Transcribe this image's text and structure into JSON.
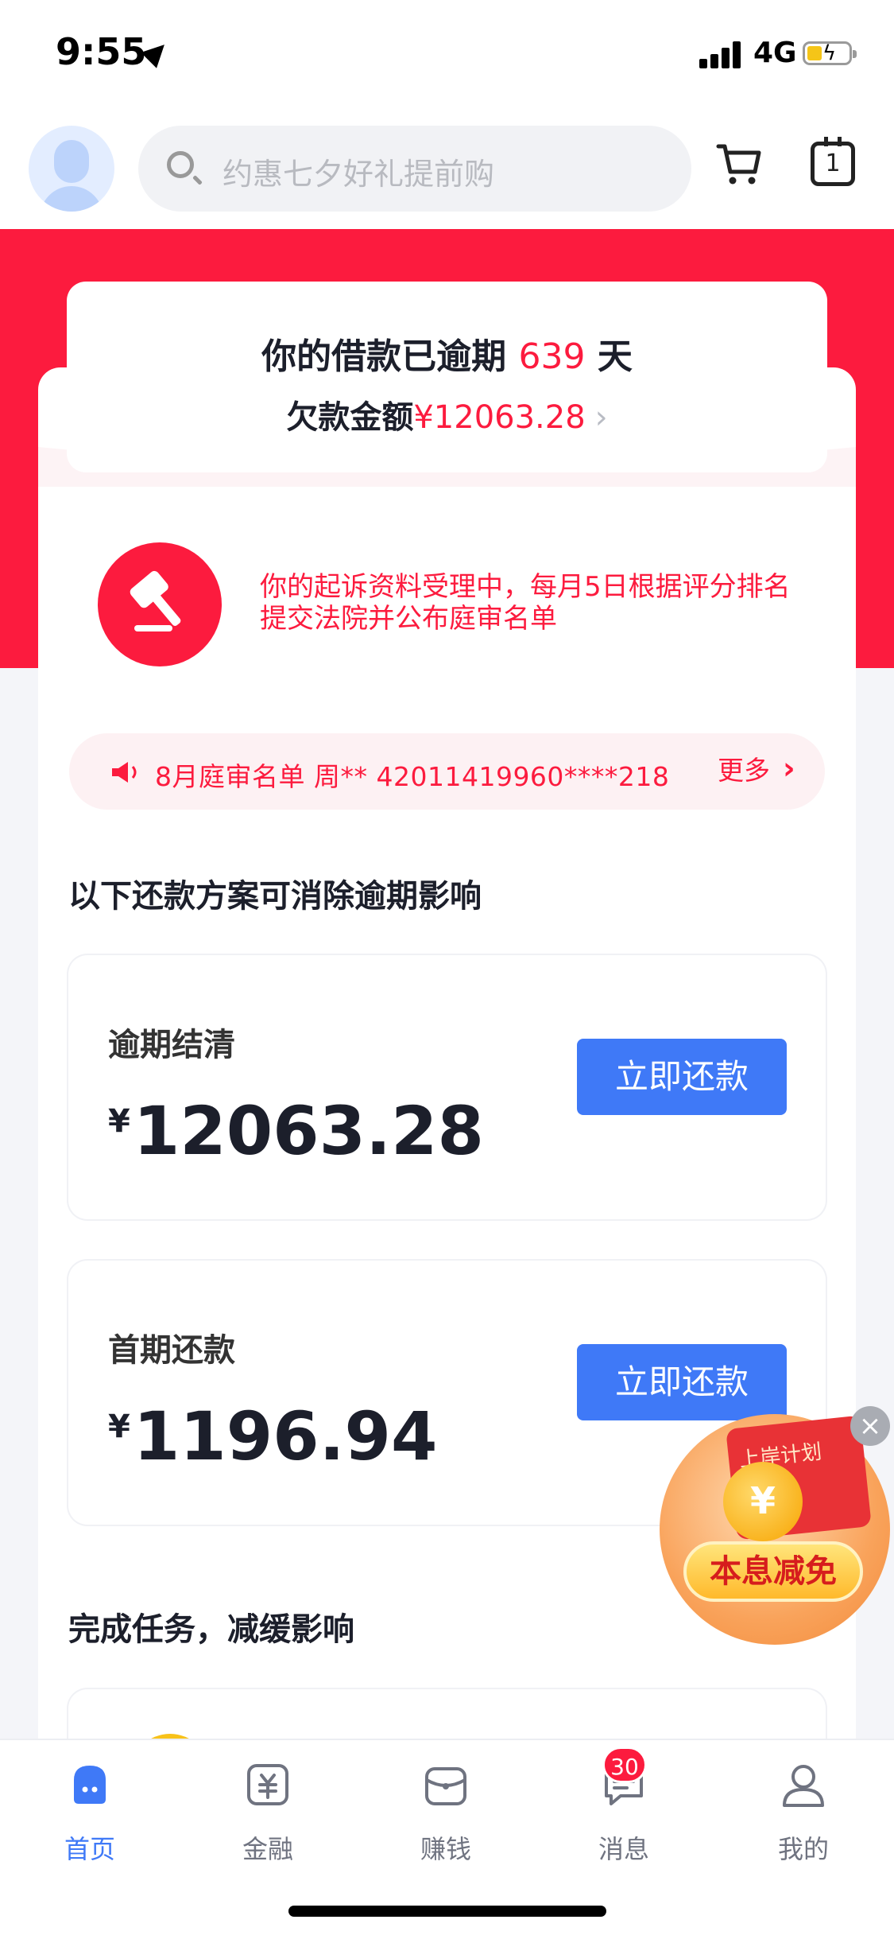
{
  "status_bar": {
    "time": "9:55",
    "network": "4G"
  },
  "header": {
    "search_placeholder": "约惠七夕好礼提前购",
    "calendar_day": "1"
  },
  "overdue": {
    "prefix": "你的借款已逾期",
    "days": "639",
    "suffix": "天",
    "amount_label": "欠款金额",
    "amount": "¥12063.28"
  },
  "lawsuit": {
    "text": "你的起诉资料受理中，每月5日根据评分排名提交法院并公布庭审名单"
  },
  "notice": {
    "text": "8月庭审名单 周** 42011419960****218",
    "more": "更多"
  },
  "plans_title": "以下还款方案可消除逾期影响",
  "plans": [
    {
      "label": "逾期结清",
      "currency": "¥",
      "amount": "12063.28",
      "button": "立即还款"
    },
    {
      "label": "首期还款",
      "currency": "¥",
      "amount": "1196.94",
      "button": "立即还款"
    }
  ],
  "tasks_title": "完成任务，减缓影响",
  "promo": {
    "envelope_text": "上岸计划",
    "pill_text": "本息减免",
    "close": "×"
  },
  "tab_bar": {
    "tabs": [
      {
        "label": "首页",
        "icon": "home-icon"
      },
      {
        "label": "金融",
        "icon": "finance-icon"
      },
      {
        "label": "赚钱",
        "icon": "wallet-icon"
      },
      {
        "label": "消息",
        "icon": "message-icon",
        "badge": "30"
      },
      {
        "label": "我的",
        "icon": "profile-icon"
      }
    ]
  },
  "colors": {
    "accent_red": "#fc1b3e",
    "accent_blue": "#3f79f7"
  }
}
